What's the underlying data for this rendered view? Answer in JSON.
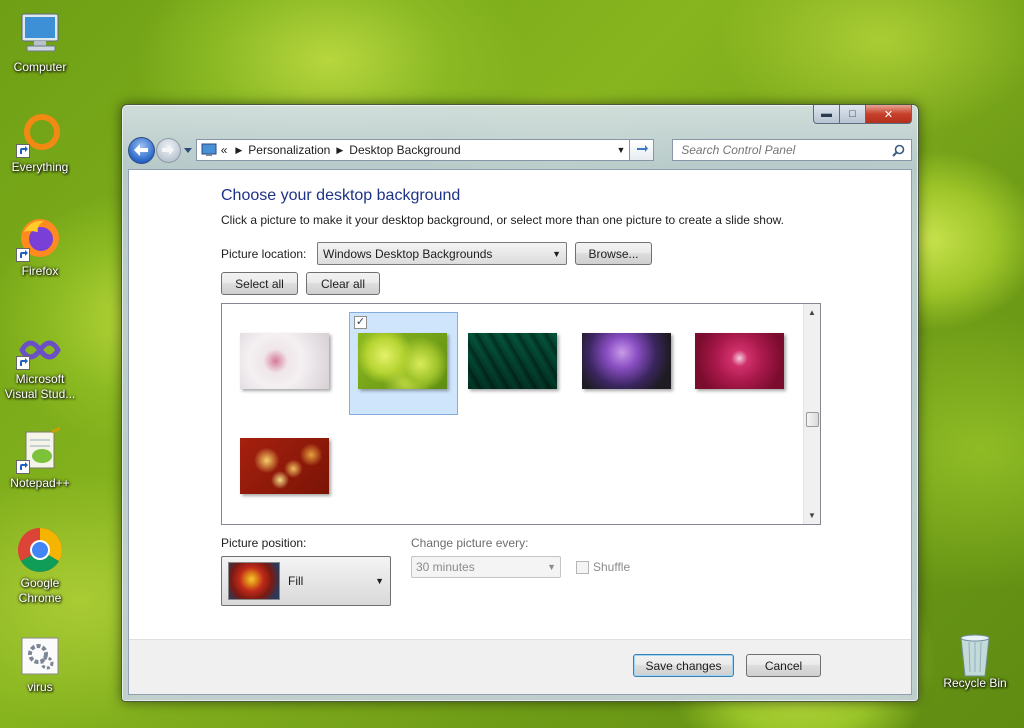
{
  "desktop": {
    "icons": [
      {
        "label": "Computer"
      },
      {
        "label": "Everything"
      },
      {
        "label": "Firefox"
      },
      {
        "label": "Microsoft Visual Stud..."
      },
      {
        "label": "Notepad++"
      },
      {
        "label": "Google Chrome"
      },
      {
        "label": "virus"
      },
      {
        "label": "Recycle Bin"
      }
    ]
  },
  "window": {
    "breadcrumb_prefix": "«",
    "breadcrumb": [
      "Personalization",
      "Desktop Background"
    ],
    "search_placeholder": "Search Control Panel",
    "heading": "Choose your desktop background",
    "subtext": "Click a picture to make it your desktop background, or select more than one picture to create a slide show.",
    "picture_location_label": "Picture location:",
    "picture_location_value": "Windows Desktop Backgrounds",
    "browse_label": "Browse...",
    "select_all_label": "Select all",
    "clear_all_label": "Clear all",
    "thumbnails": [
      {
        "name": "white-flower",
        "selected": false
      },
      {
        "name": "green-bubbles",
        "selected": true
      },
      {
        "name": "green-leaves",
        "selected": false
      },
      {
        "name": "purple-thistle",
        "selected": false
      },
      {
        "name": "red-dahlia",
        "selected": false
      },
      {
        "name": "autumn-leaves",
        "selected": false
      }
    ],
    "picture_position_label": "Picture position:",
    "picture_position_value": "Fill",
    "change_picture_label": "Change picture every:",
    "change_picture_value": "30 minutes",
    "shuffle_label": "Shuffle",
    "save_label": "Save changes",
    "cancel_label": "Cancel"
  }
}
